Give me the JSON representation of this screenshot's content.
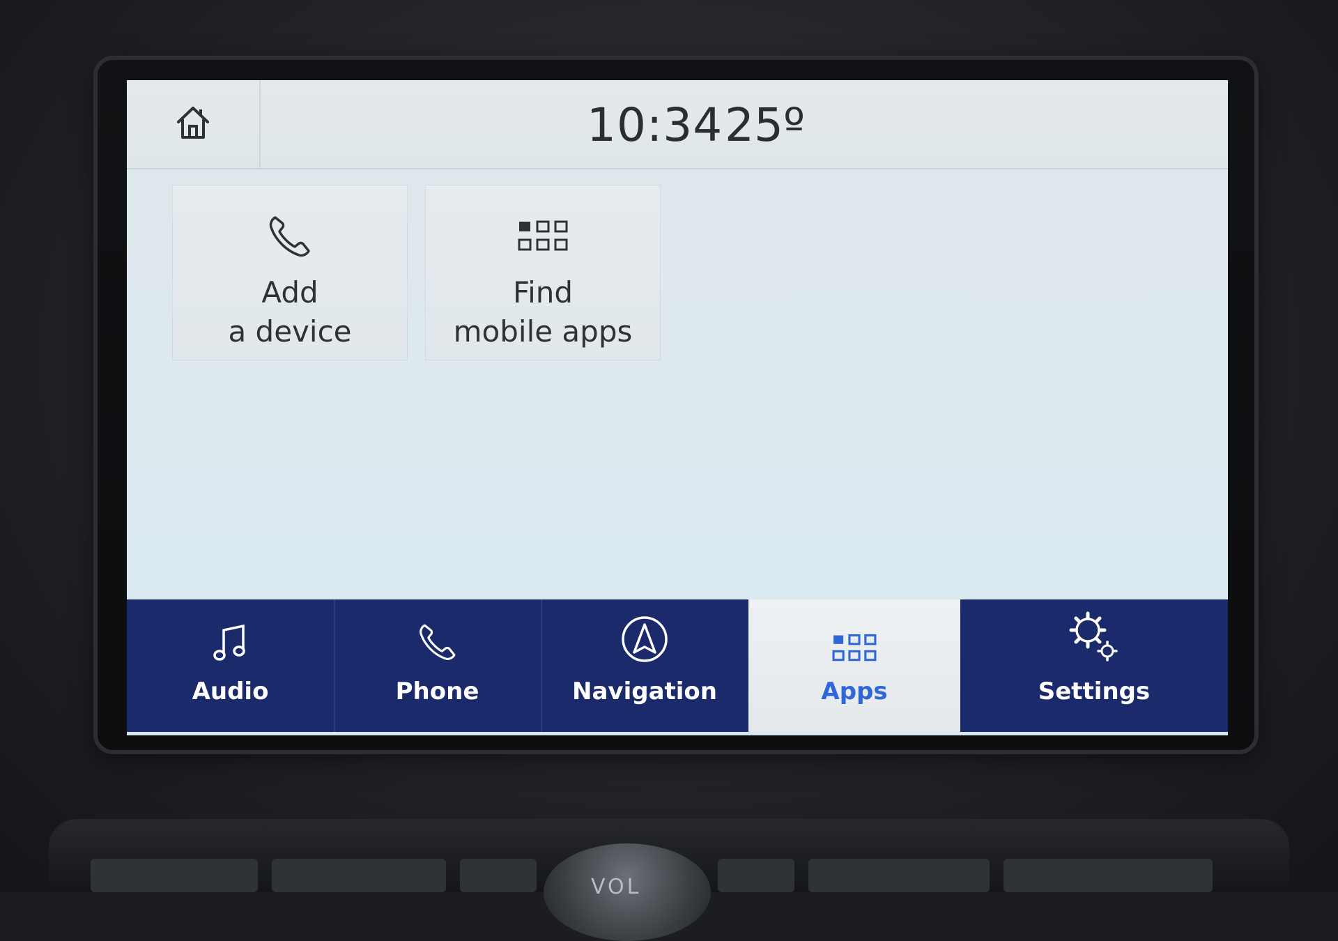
{
  "status_bar": {
    "time": "10:34",
    "temperature": "25º"
  },
  "tiles": [
    {
      "line1": "Add",
      "line2": "a device",
      "icon": "phone-icon"
    },
    {
      "line1": "Find",
      "line2": "mobile apps",
      "icon": "apps-grid-icon"
    }
  ],
  "nav": {
    "items": [
      {
        "label": "Audio",
        "icon": "music-note-icon"
      },
      {
        "label": "Phone",
        "icon": "phone-icon"
      },
      {
        "label": "Navigation",
        "icon": "compass-icon"
      },
      {
        "label": "Apps",
        "icon": "apps-grid-icon",
        "active": true
      },
      {
        "label": "Settings",
        "icon": "gear-icon"
      }
    ]
  },
  "console": {
    "knob_label": "VOL"
  },
  "colors": {
    "nav_bar": "#1b2a6b",
    "active_accent": "#2f66d9",
    "screen_bg": "#dde9ef"
  }
}
